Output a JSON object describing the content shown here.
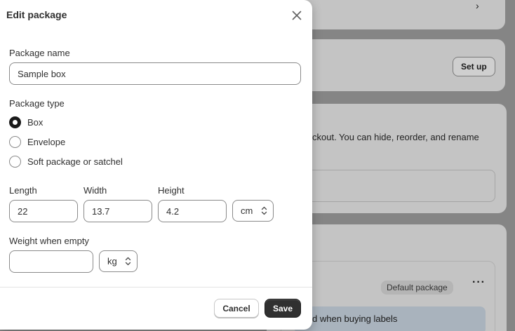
{
  "background": {
    "setup_label": "Set up",
    "info_text": "ckout. You can hide, reorder, and rename",
    "default_badge": "Default package",
    "more_icon": "more-horizontal-icon",
    "banner_text": "d when buying labels",
    "chevron_icon": "chevron-right-icon"
  },
  "modal": {
    "title": "Edit package",
    "close_icon": "close-icon",
    "package_name": {
      "label": "Package name",
      "value": "Sample box"
    },
    "package_type": {
      "label": "Package type",
      "options": [
        {
          "label": "Box",
          "checked": true
        },
        {
          "label": "Envelope",
          "checked": false
        },
        {
          "label": "Soft package or satchel",
          "checked": false
        }
      ]
    },
    "dimensions": {
      "length_label": "Length",
      "length_value": "22",
      "width_label": "Width",
      "width_value": "13.7",
      "height_label": "Height",
      "height_value": "4.2",
      "unit": "cm"
    },
    "weight": {
      "label": "Weight when empty",
      "value": "",
      "unit": "kg"
    },
    "footer": {
      "cancel_label": "Cancel",
      "save_label": "Save"
    }
  },
  "colors": {
    "overlay": "#858585",
    "primary_button": "#303030",
    "radio_checked": "#1a1a1a"
  }
}
